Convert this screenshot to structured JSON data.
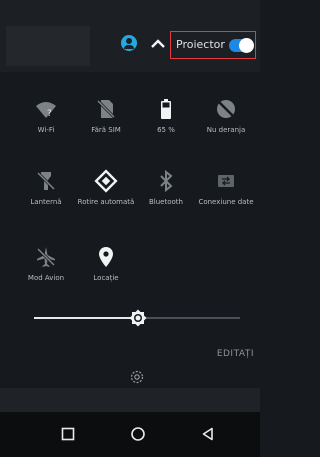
{
  "header": {
    "projector_label": "Proiector",
    "projector_toggle_on": true
  },
  "tiles": [
    {
      "label": "Wi-Fi",
      "icon": "wifi-icon"
    },
    {
      "label": "Fără SIM",
      "icon": "no-sim-icon"
    },
    {
      "label": "65 %",
      "icon": "battery-icon"
    },
    {
      "label": "Nu deranja",
      "icon": "do-not-disturb-icon"
    },
    {
      "label": "Lanternă",
      "icon": "flashlight-icon"
    },
    {
      "label": "Rotire automată",
      "icon": "auto-rotate-icon"
    },
    {
      "label": "Bluetooth",
      "icon": "bluetooth-icon"
    },
    {
      "label": "Conexiune date",
      "icon": "mobile-data-icon"
    },
    {
      "label": "Mod Avion",
      "icon": "airplane-icon"
    },
    {
      "label": "Locație",
      "icon": "location-icon"
    }
  ],
  "brightness": {
    "level": 0.5
  },
  "edit_label": "EDITAȚI",
  "nav": {
    "icons": [
      "recents-square-icon",
      "home-circle-icon",
      "back-triangle-icon"
    ]
  },
  "colors": {
    "accent": "#1e88e5",
    "highlight_box": "#e23b40",
    "avatar": "#23a9dd"
  }
}
